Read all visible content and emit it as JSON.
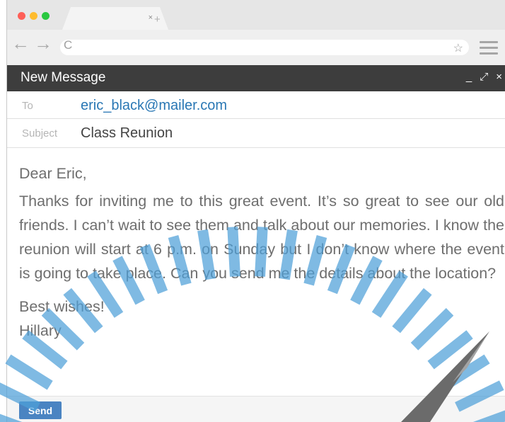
{
  "browser": {
    "traffic_lights": [
      "#fe5f57",
      "#febc2e",
      "#29c840"
    ],
    "tab_close_icon": "×",
    "new_tab_icon": "+",
    "back_icon": "←",
    "forward_icon": "→",
    "reload_icon": "C",
    "star_icon": "☆",
    "menu_icon": "hamburger-menu"
  },
  "compose": {
    "title": "New Message",
    "minimize_icon": "_",
    "expand_icon": "⤢",
    "close_icon": "×",
    "to_label": "To",
    "to_value": "eric_black@mailer.com",
    "subject_label": "Subject",
    "subject_value": "Class Reunion",
    "greeting": "Dear Eric,",
    "paragraph": "Thanks for inviting me to this great event. It’s so great to see our old friends. I can’t wait to see them and talk about our memories. I know the reunion will start at 6 p.m. on Sunday but I don’t know where the event is going to take place. Can you send me the details about the location?",
    "closing": "Best wishes!",
    "signature": "Hillary",
    "send_label": "Send"
  },
  "colors": {
    "header_bg": "#3d3d3d",
    "link_blue": "#2a77b4",
    "send_blue": "#4a84c2",
    "stripe_blue": "#4d9fd8"
  }
}
